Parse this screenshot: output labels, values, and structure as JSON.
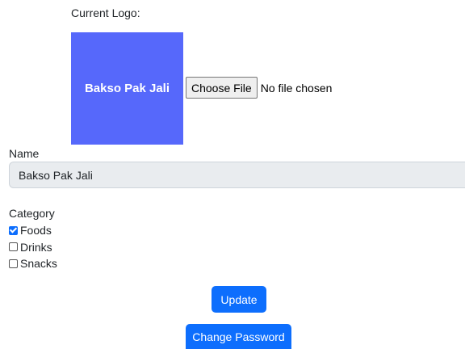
{
  "logo": {
    "label": "Current Logo:",
    "image_text": "Bakso Pak Jali",
    "background_color": "#5668fb"
  },
  "file_input": {
    "button_label": "Choose File",
    "status": "No file chosen"
  },
  "name_field": {
    "label": "Name",
    "value": "Bakso Pak Jali"
  },
  "category": {
    "label": "Category",
    "options": [
      {
        "label": "Foods",
        "checked": true
      },
      {
        "label": "Drinks",
        "checked": false
      },
      {
        "label": "Snacks",
        "checked": false
      }
    ]
  },
  "buttons": {
    "update": "Update",
    "change_password": "Change Password",
    "accent_color": "#0d6efd"
  }
}
